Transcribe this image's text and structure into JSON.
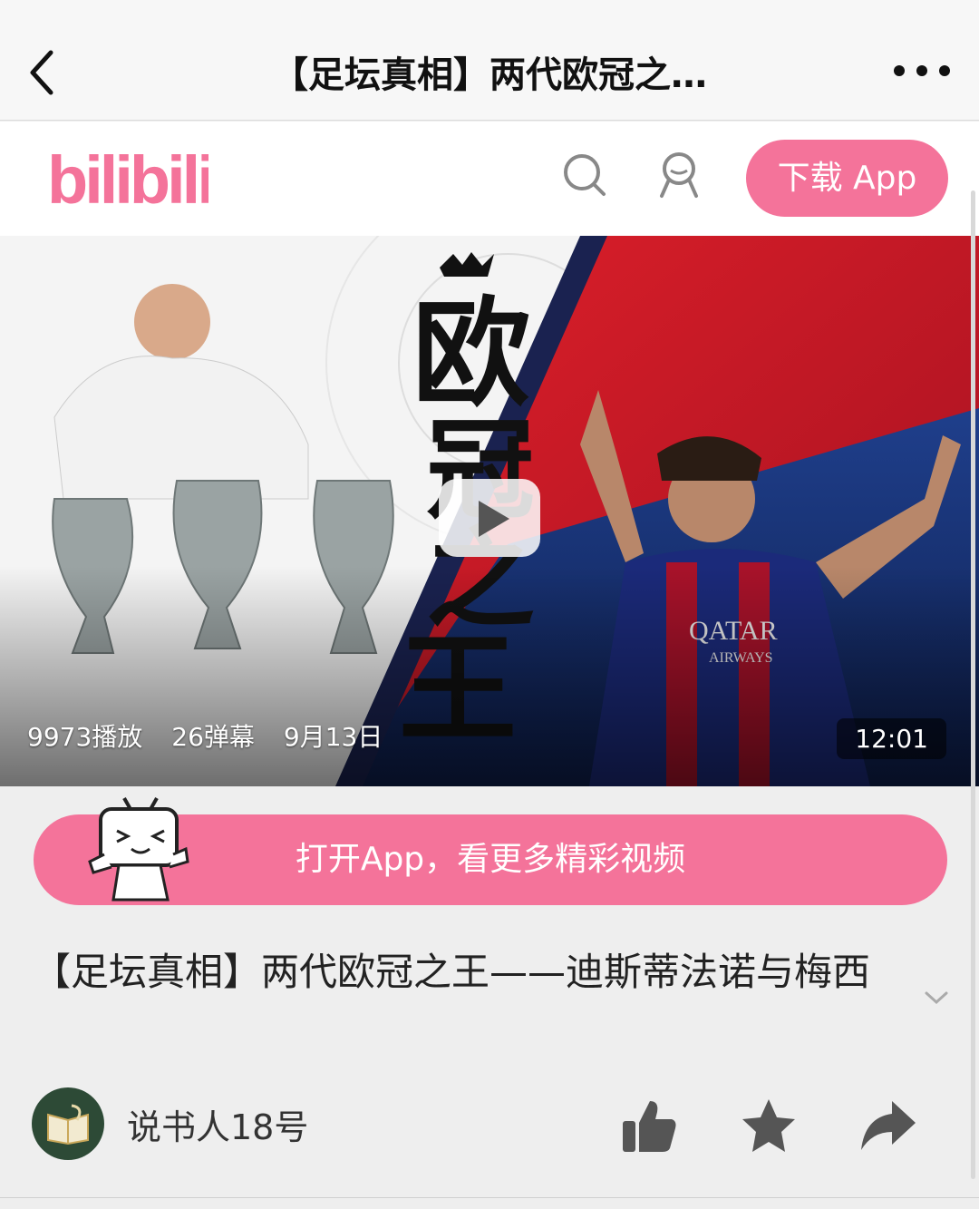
{
  "navbar": {
    "title": "【足坛真相】两代欧冠之…",
    "back_icon": "chevron-left-icon",
    "more_icon": "more-dots-icon"
  },
  "header": {
    "logo_text": "bilibili",
    "download_label": "下载 App",
    "brand_color": "#f4739a"
  },
  "video": {
    "cover_title_art": "欧冠之王",
    "plays": "9973播放",
    "danmaku": "26弹幕",
    "date": "9月13日",
    "duration": "12:01"
  },
  "banner": {
    "label": "打开App，看更多精彩视频"
  },
  "detail": {
    "title": "【足坛真相】两代欧冠之王——迪斯蒂法诺与梅西"
  },
  "author": {
    "name": "说书人18号"
  },
  "actions": [
    "like-icon",
    "favorite-icon",
    "share-icon"
  ]
}
